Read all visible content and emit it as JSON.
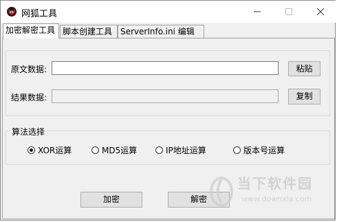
{
  "window": {
    "title": "网狐工具"
  },
  "tabs": [
    "加密解密工具",
    "脚本创建工具",
    "ServerInfo.ini 编辑器"
  ],
  "form": {
    "source_label": "原文数据:",
    "source_value": "",
    "paste_button": "粘贴",
    "result_label": "结果数据:",
    "result_value": "",
    "copy_button": "复制"
  },
  "algorithm": {
    "legend": "算法选择",
    "options": [
      "XOR运算",
      "MD5运算",
      "IP地址运算",
      "版本号运算"
    ],
    "selected": "XOR运算"
  },
  "actions": {
    "encrypt": "加密",
    "decrypt": "解密"
  },
  "watermark": {
    "title": "当下软件园",
    "url": "www.downxia.com"
  }
}
